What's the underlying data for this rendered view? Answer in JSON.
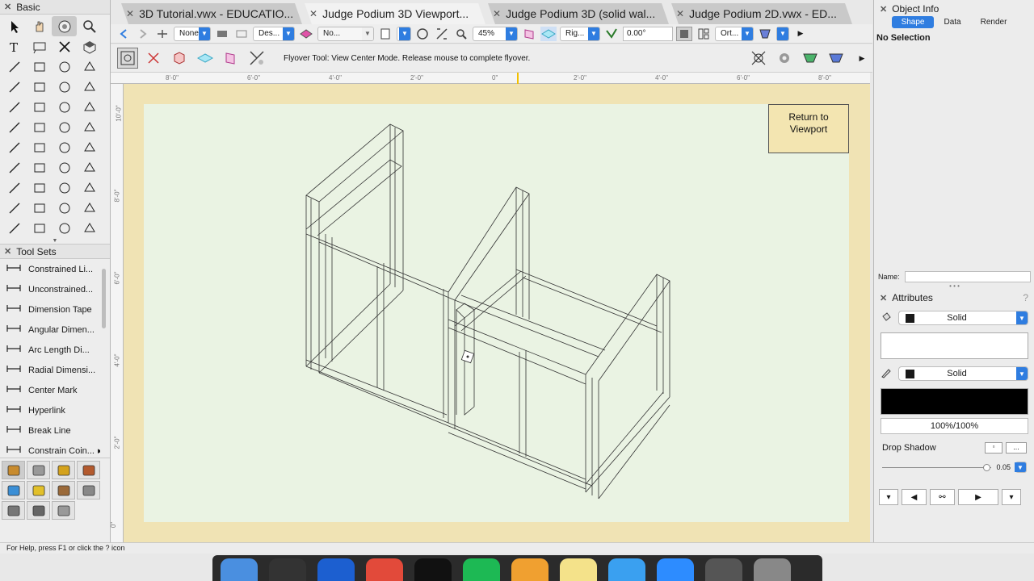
{
  "left_palette": {
    "title": "Basic",
    "tools": [
      "selection-tool-icon",
      "pan-tool-icon",
      "flyover-tool-icon",
      "zoom-tool-icon",
      "text-tool-icon",
      "callout-tool-icon",
      "locus-tool-icon",
      "3d-locus-tool-icon",
      "line-tool-icon",
      "double-line-tool-icon",
      "rectangle-tool-icon",
      "rounded-rectangle-tool-icon",
      "circle-tool-icon",
      "oval-tool-icon",
      "arc-tool-icon",
      "freehand-tool-icon",
      "polyline-tool-icon",
      "polygon-tool-icon",
      "double-line-polygon-tool-icon",
      "regular-polygon-tool-icon",
      "spiral-tool-icon",
      "eyedropper-tool-icon",
      "attribute-mapping-tool-icon",
      "visibility-tool-icon",
      "resize-tool-icon",
      "offset-tool-icon",
      "rotate-tool-icon",
      "mirror-tool-icon",
      "reshape-tool-icon",
      "split-tool-icon",
      "connect-tool-icon",
      "fillet-tool-icon",
      "chamfer-tool-icon",
      "fillet-arc-tool-icon",
      "clip-tool-icon",
      "move-by-points-tool-icon",
      "dimension-tool-icon",
      "dimension-chain-tool-icon",
      "angle-dimension-tool-icon",
      "revision-cloud-tool-icon",
      "protractor-tool-icon",
      "mouse-position-tool-icon",
      "angular-measure-tool-icon",
      "cylinder-tool-icon"
    ]
  },
  "toolsets": {
    "title": "Tool Sets",
    "items": [
      {
        "label": "Constrained Li...",
        "icon": "constrained-linear-icon"
      },
      {
        "label": "Unconstrained...",
        "icon": "unconstrained-linear-icon"
      },
      {
        "label": "Dimension Tape",
        "icon": "dimension-tape-icon"
      },
      {
        "label": "Angular Dimen...",
        "icon": "angular-dimension-icon"
      },
      {
        "label": "Arc Length Di...",
        "icon": "arc-length-dimension-icon"
      },
      {
        "label": "Radial Dimensi...",
        "icon": "radial-dimension-icon"
      },
      {
        "label": "Center Mark",
        "icon": "center-mark-icon"
      },
      {
        "label": "Hyperlink",
        "icon": "hyperlink-icon"
      },
      {
        "label": "Break Line",
        "icon": "break-line-icon"
      },
      {
        "label": "Constrain Coin...",
        "icon": "constrain-coincident-icon"
      }
    ],
    "set_icons": [
      "basic-set-icon",
      "walls-set-icon",
      "visualization-set-icon",
      "building-shell-set-icon",
      "site-planning-set-icon",
      "lighting-set-icon",
      "furniture-set-icon",
      "dims-notes-set-icon",
      "fabrication-set-icon",
      "mechanical-set-icon",
      "settings-set-icon"
    ]
  },
  "tabs": [
    {
      "label": "3D Tutorial.vwx - EDUCATIO...",
      "active": false
    },
    {
      "label": "Judge Podium 3D Viewport...",
      "active": true
    },
    {
      "label": "Judge Podium 3D (solid wal...",
      "active": false
    },
    {
      "label": "Judge Podium 2D.vwx - ED...",
      "active": false
    }
  ],
  "view_bar": {
    "class_value": "None",
    "layer_value": "Des...",
    "render_value": "No...",
    "zoom_value": "45%",
    "view_value": "Rig...",
    "angle_value": "0.00°",
    "projection_value": "Ort..."
  },
  "mode_bar": {
    "hint": "Flyover Tool: View Center Mode. Release mouse to complete flyover."
  },
  "rulers": {
    "top_labels": [
      "8'-0\"",
      "6'-0\"",
      "4'-0\"",
      "2'-0\"",
      "0\"",
      "2'-0\"",
      "4'-0\"",
      "6'-0\"",
      "8'-0\""
    ],
    "left_labels": [
      "10'-0\"",
      "8'-0\"",
      "6'-0\"",
      "4'-0\"",
      "2'-0\"",
      "0\""
    ]
  },
  "canvas": {
    "return_button": "Return to Viewport"
  },
  "object_info": {
    "title": "Object Info",
    "tabs": [
      "Shape",
      "Data",
      "Render"
    ],
    "active_tab": "Shape",
    "selection": "No Selection",
    "name_label": "Name:",
    "name_value": ""
  },
  "attributes": {
    "title": "Attributes",
    "fill_style": "Solid",
    "fill_color": "#ffffff",
    "pen_style": "Solid",
    "pen_color": "#000000",
    "opacity": "100%/100%",
    "drop_shadow": "Drop Shadow",
    "more_label": "...",
    "line_weight": "0.05",
    "line_weight_fraction": 0.96
  },
  "status": {
    "text": "For Help, press F1 or click the ? icon"
  },
  "dock_apps": [
    "finder",
    "clock",
    "safari",
    "chrome",
    "vectorworks",
    "spotify",
    "photos",
    "notes",
    "messages",
    "zoom",
    "printer",
    "trash"
  ]
}
